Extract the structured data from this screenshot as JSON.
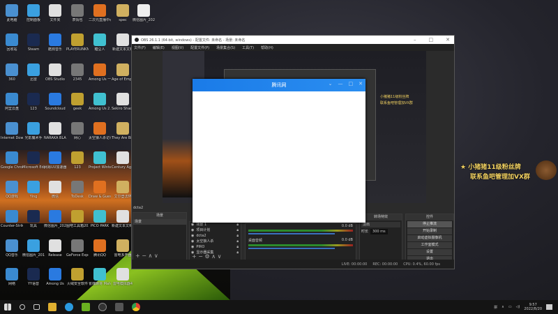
{
  "desktop": {
    "icons": [
      [
        "此电脑",
        "控制面板",
        "文件夹",
        "表情包",
        "二次元直播中心",
        "spec"
      ],
      [
        "回收站",
        "Steam",
        "酷狗音乐",
        "PLAYERUNKNOWN'S BATTLEGROUNDS",
        "糖豆人",
        "新建文本文档"
      ],
      [
        "360",
        "迅雷",
        "OBS Studio",
        "2345",
        "Among Us 一键",
        "Age of Empires IV"
      ],
      [
        "阿里云盘",
        "123",
        "Soundcloud",
        "geek",
        "Among Us 2.6.7",
        "Sekiro Shadows"
      ],
      [
        "Internet Download",
        "光影魔术手",
        "NARAKA BLADEPOINT",
        "网心",
        "太空狼人杀记事本",
        "They Are Billions"
      ],
      [
        "Google Chrome",
        "Microsoft Edge",
        "网易UU加速器",
        "123",
        "Project Winter",
        "Century Age of Ashes"
      ],
      [
        "QQ游戏",
        "Ying",
        "微信",
        "ToDesk",
        "Draw & Guess",
        "艾尔登法环"
      ],
      [
        "Counter-Strike Global Off",
        "玩具",
        "微信图片_2020101",
        "图吧工具箱2020",
        "PICO PARK",
        "新建文本文档(2)"
      ],
      [
        "QQ音乐",
        "微信图片_2018101",
        "Release",
        "GeForce Experience",
        "腾讯QQ",
        "雷电多开器"
      ],
      [
        "网络",
        "YY语音",
        "Among Us",
        "火绒安全软件",
        "雀魂麻将 Mahjong",
        "雷电模拟器4"
      ]
    ],
    "extra_icon": "微信图片_2022...",
    "colors": [
      "#4a90d0",
      "#3aa0e0",
      "#e0e0e0",
      "#777",
      "#e07020",
      "#d0b060",
      "#3a8ad0",
      "#1a2a50",
      "#2a7ae0",
      "#c0a030",
      "#40c0d0",
      "#e0e0e0"
    ]
  },
  "obs": {
    "title": "OBS 26.1.1 (64-bit, windows) - 配置文件: 未命名 - 场景: 未命名",
    "menu": [
      "文件(F)",
      "编辑(E)",
      "视图(V)",
      "配置文件(P)",
      "场景集合(S)",
      "工具(T)",
      "帮助(H)"
    ],
    "scene_label": "dcta2",
    "scenes_header": "场景",
    "scenes": [
      "场景"
    ],
    "sources": [
      "场景 1",
      "项目计划",
      "dcta2",
      "太空狼人杀",
      "PIRO",
      "显示器采集"
    ],
    "mixer": {
      "track1_db": "0.0 dB",
      "track2": "桌面音频",
      "track2_db": "0.0 dB"
    },
    "transitions_header": "转场特效",
    "transition": "淡出",
    "duration_label": "时长",
    "duration": "300 ms",
    "controls_header": "控件",
    "controls": [
      "停止推流",
      "开始录制",
      "启动虚拟摄像机",
      "工作室模式",
      "设置",
      "退出"
    ],
    "status": {
      "live": "LIVE: 00:00:00",
      "rec": "REC: 00:00:00",
      "cpu": "CPU: 0.4%, 60.00 fps"
    }
  },
  "dialog": {
    "title": "腾讯网",
    "controls": [
      "⌄",
      "—",
      "□",
      "✕"
    ]
  },
  "overlay": {
    "line1": "小猪猪11级粉丝牌",
    "line2": "联系鱼吧管理加VX群"
  },
  "taskbar": {
    "time": "9:57",
    "date": "2022/8/20",
    "lang": "拼"
  }
}
